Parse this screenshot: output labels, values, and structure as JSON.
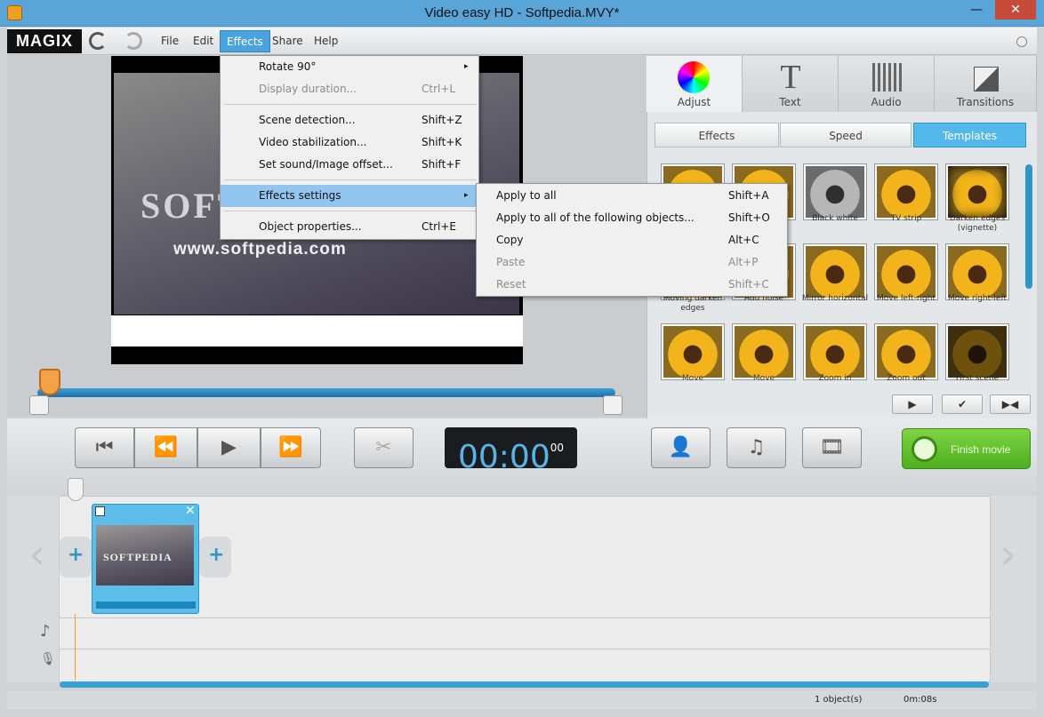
{
  "window": {
    "title": "Video easy HD - Softpedia.MVY*",
    "minimize": "—",
    "close": "✕"
  },
  "menubar": {
    "logo": "MAGIX",
    "items": [
      "File",
      "Edit",
      "Effects",
      "Share",
      "Help"
    ]
  },
  "preview": {
    "video_text": "SOFT",
    "video_url": "www.softpedia.com"
  },
  "effects_menu": [
    {
      "label": "Rotate 90°",
      "shortcut": "",
      "submenu": "▸"
    },
    {
      "label": "Display duration...",
      "shortcut": "Ctrl+L"
    },
    {
      "label": "Scene detection...",
      "shortcut": "Shift+Z"
    },
    {
      "label": "Video stabilization...",
      "shortcut": "Shift+K"
    },
    {
      "label": "Set sound/Image offset...",
      "shortcut": "Shift+F"
    },
    {
      "label": "Effects settings",
      "shortcut": "",
      "submenu": "▸"
    },
    {
      "label": "Object properties...",
      "shortcut": "Ctrl+E"
    }
  ],
  "submenu": [
    {
      "label": "Apply to all",
      "shortcut": "Shift+A"
    },
    {
      "label": "Apply to all of the following objects...",
      "shortcut": "Shift+O"
    },
    {
      "label": "Copy",
      "shortcut": "Alt+C"
    },
    {
      "label": "Paste",
      "shortcut": "Alt+P"
    },
    {
      "label": "Reset",
      "shortcut": "Shift+C"
    }
  ],
  "panel": {
    "tabs": [
      "Adjust",
      "Text",
      "Audio",
      "Transitions"
    ],
    "text_glyph": "T",
    "subtabs": [
      "Effects",
      "Speed",
      "Templates"
    ],
    "templates": [
      "",
      "",
      "Black white",
      "TV strip",
      "Darken edges (vignette)",
      "Moving darken edges",
      "Add noise",
      "Mirror horizontal",
      "Move left-right",
      "Move right-left",
      "Move",
      "Move",
      "Zoom in",
      "Zoom out",
      "First scene"
    ],
    "controls": [
      "▶",
      "✔",
      "▶◀"
    ]
  },
  "transport": {
    "time": "00:00",
    "frames": "00",
    "buttons": [
      "⏮",
      "⏪",
      "▶",
      "⏩"
    ],
    "scissors": "✂",
    "add": [
      "👤",
      "♫",
      "🎞"
    ],
    "finish": "Finish movie"
  },
  "timeline": {
    "clip_text": "SOFTPEDIA",
    "clip_plus": "+",
    "music_icon": "♪",
    "mic_icon": "🎙"
  },
  "status": {
    "objects": "1 object(s)",
    "duration": "0m:08s"
  }
}
